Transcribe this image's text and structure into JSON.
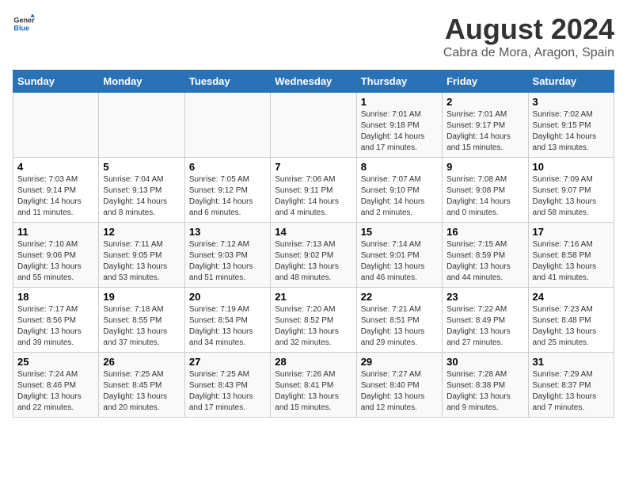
{
  "header": {
    "logo_general": "General",
    "logo_blue": "Blue",
    "title": "August 2024",
    "subtitle": "Cabra de Mora, Aragon, Spain"
  },
  "days_of_week": [
    "Sunday",
    "Monday",
    "Tuesday",
    "Wednesday",
    "Thursday",
    "Friday",
    "Saturday"
  ],
  "weeks": [
    [
      {
        "day": "",
        "info": ""
      },
      {
        "day": "",
        "info": ""
      },
      {
        "day": "",
        "info": ""
      },
      {
        "day": "",
        "info": ""
      },
      {
        "day": "1",
        "info": "Sunrise: 7:01 AM\nSunset: 9:18 PM\nDaylight: 14 hours and 17 minutes."
      },
      {
        "day": "2",
        "info": "Sunrise: 7:01 AM\nSunset: 9:17 PM\nDaylight: 14 hours and 15 minutes."
      },
      {
        "day": "3",
        "info": "Sunrise: 7:02 AM\nSunset: 9:15 PM\nDaylight: 14 hours and 13 minutes."
      }
    ],
    [
      {
        "day": "4",
        "info": "Sunrise: 7:03 AM\nSunset: 9:14 PM\nDaylight: 14 hours and 11 minutes."
      },
      {
        "day": "5",
        "info": "Sunrise: 7:04 AM\nSunset: 9:13 PM\nDaylight: 14 hours and 8 minutes."
      },
      {
        "day": "6",
        "info": "Sunrise: 7:05 AM\nSunset: 9:12 PM\nDaylight: 14 hours and 6 minutes."
      },
      {
        "day": "7",
        "info": "Sunrise: 7:06 AM\nSunset: 9:11 PM\nDaylight: 14 hours and 4 minutes."
      },
      {
        "day": "8",
        "info": "Sunrise: 7:07 AM\nSunset: 9:10 PM\nDaylight: 14 hours and 2 minutes."
      },
      {
        "day": "9",
        "info": "Sunrise: 7:08 AM\nSunset: 9:08 PM\nDaylight: 14 hours and 0 minutes."
      },
      {
        "day": "10",
        "info": "Sunrise: 7:09 AM\nSunset: 9:07 PM\nDaylight: 13 hours and 58 minutes."
      }
    ],
    [
      {
        "day": "11",
        "info": "Sunrise: 7:10 AM\nSunset: 9:06 PM\nDaylight: 13 hours and 55 minutes."
      },
      {
        "day": "12",
        "info": "Sunrise: 7:11 AM\nSunset: 9:05 PM\nDaylight: 13 hours and 53 minutes."
      },
      {
        "day": "13",
        "info": "Sunrise: 7:12 AM\nSunset: 9:03 PM\nDaylight: 13 hours and 51 minutes."
      },
      {
        "day": "14",
        "info": "Sunrise: 7:13 AM\nSunset: 9:02 PM\nDaylight: 13 hours and 48 minutes."
      },
      {
        "day": "15",
        "info": "Sunrise: 7:14 AM\nSunset: 9:01 PM\nDaylight: 13 hours and 46 minutes."
      },
      {
        "day": "16",
        "info": "Sunrise: 7:15 AM\nSunset: 8:59 PM\nDaylight: 13 hours and 44 minutes."
      },
      {
        "day": "17",
        "info": "Sunrise: 7:16 AM\nSunset: 8:58 PM\nDaylight: 13 hours and 41 minutes."
      }
    ],
    [
      {
        "day": "18",
        "info": "Sunrise: 7:17 AM\nSunset: 8:56 PM\nDaylight: 13 hours and 39 minutes."
      },
      {
        "day": "19",
        "info": "Sunrise: 7:18 AM\nSunset: 8:55 PM\nDaylight: 13 hours and 37 minutes."
      },
      {
        "day": "20",
        "info": "Sunrise: 7:19 AM\nSunset: 8:54 PM\nDaylight: 13 hours and 34 minutes."
      },
      {
        "day": "21",
        "info": "Sunrise: 7:20 AM\nSunset: 8:52 PM\nDaylight: 13 hours and 32 minutes."
      },
      {
        "day": "22",
        "info": "Sunrise: 7:21 AM\nSunset: 8:51 PM\nDaylight: 13 hours and 29 minutes."
      },
      {
        "day": "23",
        "info": "Sunrise: 7:22 AM\nSunset: 8:49 PM\nDaylight: 13 hours and 27 minutes."
      },
      {
        "day": "24",
        "info": "Sunrise: 7:23 AM\nSunset: 8:48 PM\nDaylight: 13 hours and 25 minutes."
      }
    ],
    [
      {
        "day": "25",
        "info": "Sunrise: 7:24 AM\nSunset: 8:46 PM\nDaylight: 13 hours and 22 minutes."
      },
      {
        "day": "26",
        "info": "Sunrise: 7:25 AM\nSunset: 8:45 PM\nDaylight: 13 hours and 20 minutes."
      },
      {
        "day": "27",
        "info": "Sunrise: 7:25 AM\nSunset: 8:43 PM\nDaylight: 13 hours and 17 minutes."
      },
      {
        "day": "28",
        "info": "Sunrise: 7:26 AM\nSunset: 8:41 PM\nDaylight: 13 hours and 15 minutes."
      },
      {
        "day": "29",
        "info": "Sunrise: 7:27 AM\nSunset: 8:40 PM\nDaylight: 13 hours and 12 minutes."
      },
      {
        "day": "30",
        "info": "Sunrise: 7:28 AM\nSunset: 8:38 PM\nDaylight: 13 hours and 9 minutes."
      },
      {
        "day": "31",
        "info": "Sunrise: 7:29 AM\nSunset: 8:37 PM\nDaylight: 13 hours and 7 minutes."
      }
    ]
  ]
}
